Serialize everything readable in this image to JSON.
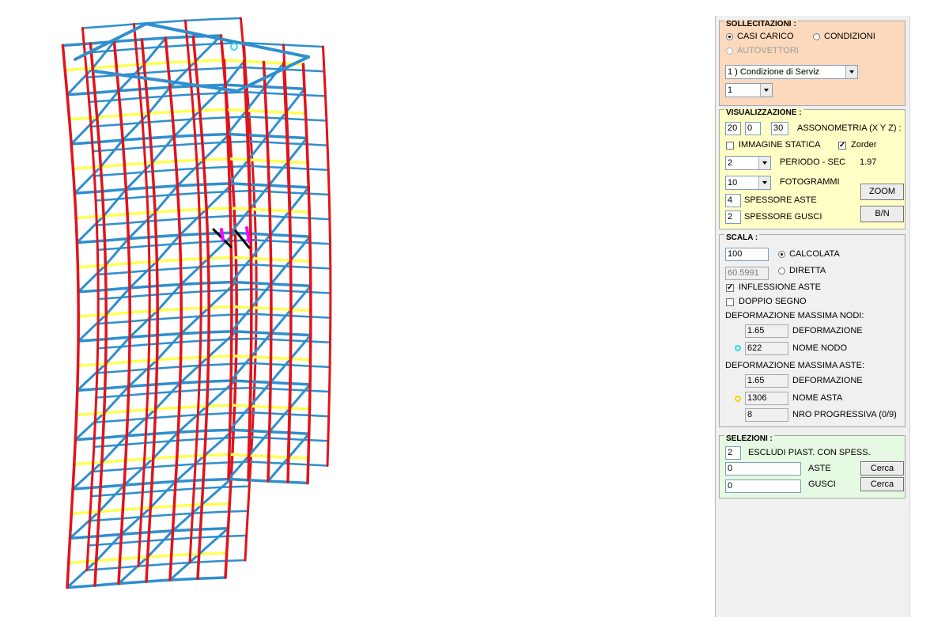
{
  "colors": {
    "column": "#e0141c",
    "beam": "#2e8fcf",
    "slab_edge": "#ffff55",
    "node_marker": "#33dde6",
    "beam_marker": "#f2d600",
    "accent_magenta": "#ff00ff"
  },
  "sollecitazioni": {
    "title": "SOLLECITAZIONI :",
    "casi_carico": "CASI CARICO",
    "condizioni": "CONDIZIONI",
    "autovettori": "AUTOVETTORI",
    "selected": "casi_carico",
    "condition_select": "1 ) Condizione di Serviz",
    "index_select": "1"
  },
  "visualizzazione": {
    "title": "VISUALIZZAZIONE :",
    "axo_x": "20",
    "axo_y": "0",
    "axo_z": "30",
    "axo_label": "ASSONOMETRIA (X Y Z) :",
    "immagine_statica": "IMMAGINE STATICA",
    "immagine_statica_checked": false,
    "zorder": "Zorder",
    "zorder_checked": true,
    "periodo_select": "2",
    "periodo_label": "PERIODO - SEC",
    "periodo_value": "1.97",
    "fotogrammi_select": "10",
    "fotogrammi_label": "FOTOGRAMMI",
    "zoom_button": "ZOOM",
    "bn_button": "B/N",
    "spessore_aste_value": "4",
    "spessore_aste_label": "SPESSORE ASTE",
    "spessore_gusci_value": "2",
    "spessore_gusci_label": "SPESSORE GUSCI"
  },
  "scala": {
    "title": "SCALA :",
    "scale_value": "100",
    "calcolata": "CALCOLATA",
    "direct_value": "60.5991",
    "diretta": "DIRETTA",
    "selected": "calcolata",
    "inflessione_aste": "INFLESSIONE ASTE",
    "inflessione_checked": true,
    "doppio_segno": "DOPPIO SEGNO",
    "doppio_checked": false,
    "def_max_nodi": "DEFORMAZIONE MASSIMA NODI:",
    "nodi_deformazione_value": "1.65",
    "nodi_deformazione_label": "DEFORMAZIONE",
    "nome_nodo_value": "622",
    "nome_nodo_label": "NOME NODO",
    "def_max_aste": "DEFORMAZIONE MASSIMA ASTE:",
    "aste_deformazione_value": "1.65",
    "aste_deformazione_label": "DEFORMAZIONE",
    "nome_asta_value": "1306",
    "nome_asta_label": "NOME ASTA",
    "nro_progressiva_value": "8",
    "nro_progressiva_label": "NRO PROGRESSIVA (0/9)"
  },
  "selezioni": {
    "title": "SELEZIONI :",
    "escludi_value": "2",
    "escludi_label": "ESCLUDI PIAST. CON SPESS.",
    "aste_value": "0",
    "aste_label": "ASTE",
    "gusci_value": "0",
    "gusci_label": "GUSCI",
    "cerca_aste": "Cerca",
    "cerca_gusci": "Cerca"
  }
}
